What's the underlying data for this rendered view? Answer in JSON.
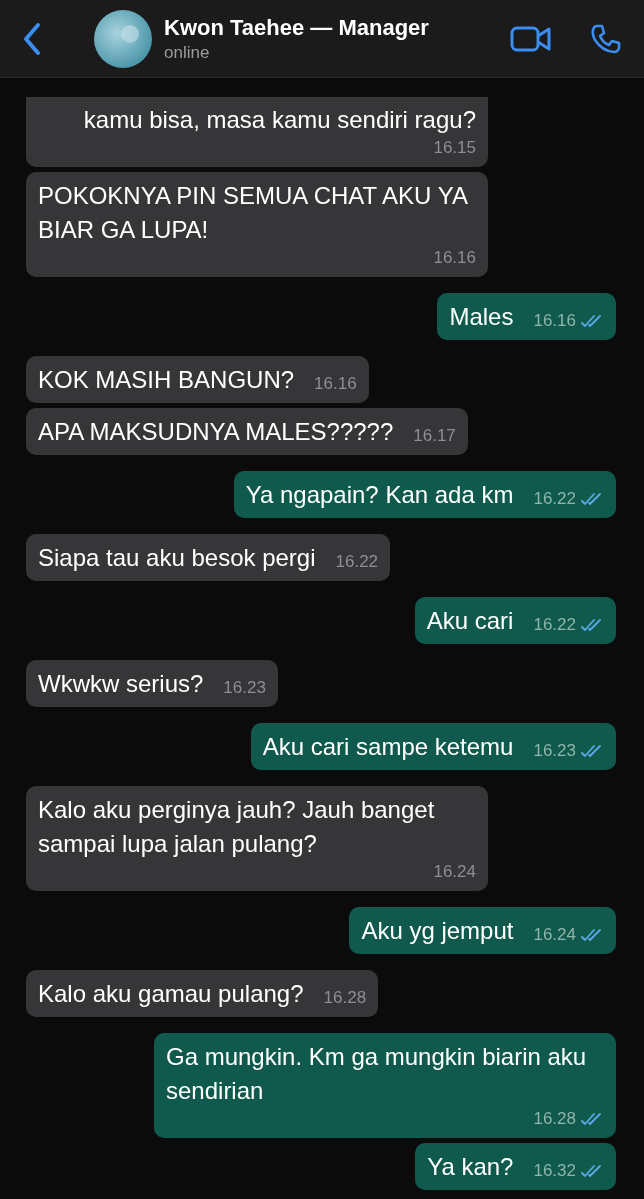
{
  "header": {
    "contact_name": "Kwon Taehee — Manager",
    "status": "online"
  },
  "messages": [
    {
      "kind": "in",
      "text": "kamu bisa, masa kamu sendiri ragu?",
      "time": "16.15",
      "clipped": true
    },
    {
      "kind": "in",
      "text": "POKOKNYA PIN SEMUA CHAT AKU YA BIAR GA LUPA!",
      "time": "16.16"
    },
    {
      "kind": "out",
      "text": "Males",
      "time": "16.16",
      "read": true
    },
    {
      "kind": "in",
      "text": "KOK MASIH BANGUN?",
      "time": "16.16"
    },
    {
      "kind": "in",
      "text": "APA MAKSUDNYA MALES?????",
      "time": "16.17"
    },
    {
      "kind": "out",
      "text": "Ya ngapain? Kan ada km",
      "time": "16.22",
      "read": true
    },
    {
      "kind": "in",
      "text": "Siapa tau aku besok pergi",
      "time": "16.22"
    },
    {
      "kind": "out",
      "text": "Aku cari",
      "time": "16.22",
      "read": true
    },
    {
      "kind": "in",
      "text": "Wkwkw serius?",
      "time": "16.23"
    },
    {
      "kind": "out",
      "text": "Aku cari sampe ketemu",
      "time": "16.23",
      "read": true
    },
    {
      "kind": "in",
      "text": "Kalo aku perginya jauh? Jauh banget sampai lupa jalan pulang?",
      "time": "16.24"
    },
    {
      "kind": "out",
      "text": "Aku yg jemput",
      "time": "16.24",
      "read": true
    },
    {
      "kind": "in",
      "text": "Kalo aku gamau pulang?",
      "time": "16.28"
    },
    {
      "kind": "out",
      "text": "Ga mungkin. Km ga mungkin biarin aku sendirian",
      "time": "16.28",
      "read": true
    },
    {
      "kind": "out",
      "text": "Ya kan?",
      "time": "16.32",
      "read": true
    }
  ]
}
